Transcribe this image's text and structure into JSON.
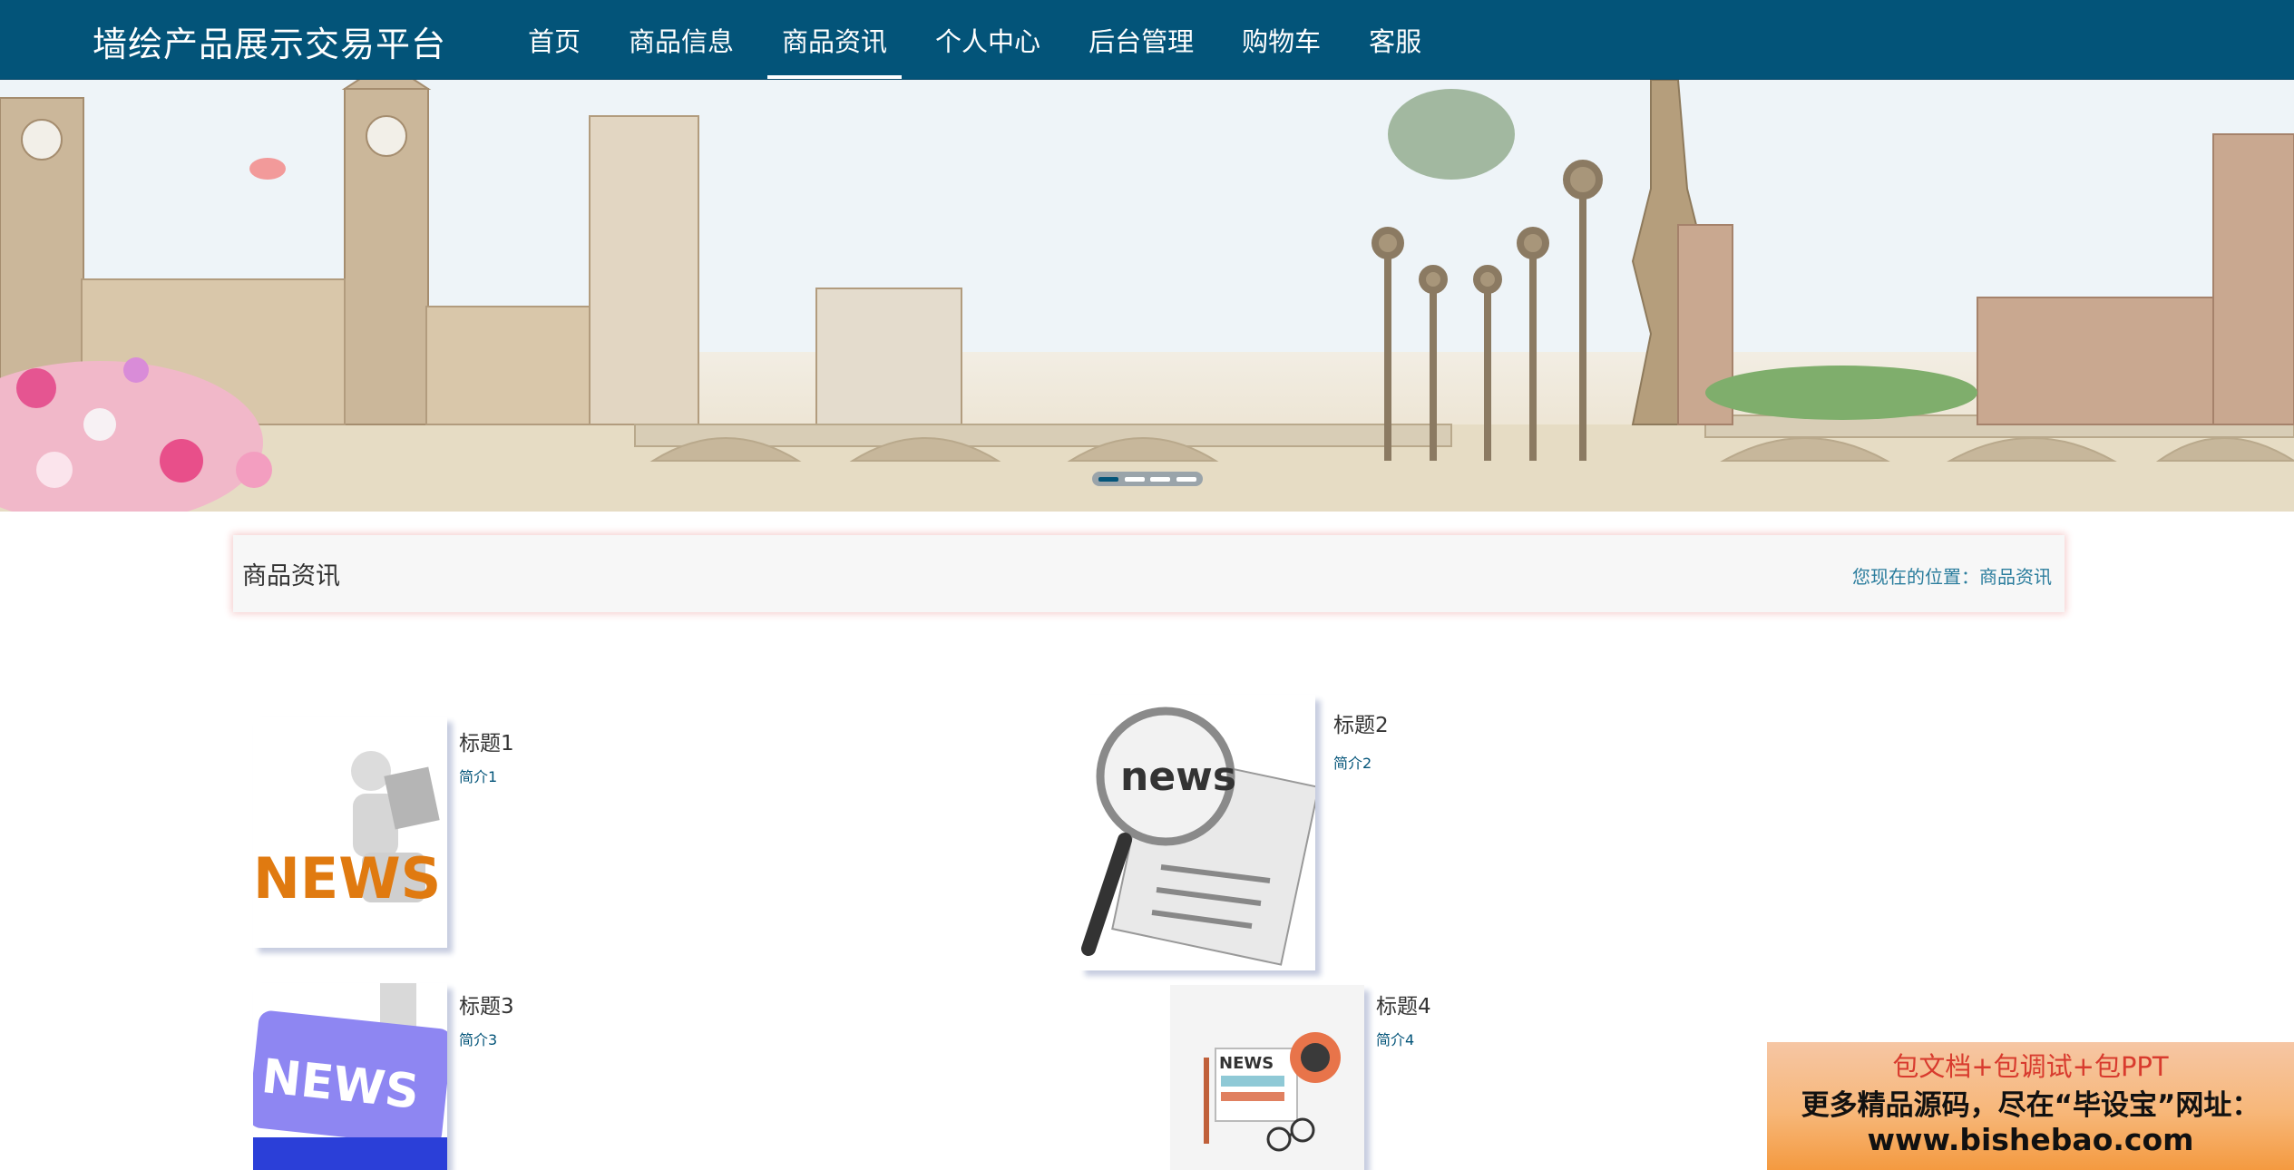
{
  "header": {
    "site_title": "墙绘产品展示交易平台",
    "nav": [
      {
        "label": "首页"
      },
      {
        "label": "商品信息"
      },
      {
        "label": "商品资讯"
      },
      {
        "label": "个人中心"
      },
      {
        "label": "后台管理"
      },
      {
        "label": "购物车"
      },
      {
        "label": "客服"
      }
    ],
    "active_nav": "商品资讯"
  },
  "banner": {
    "slide_count": 4,
    "active_slide": 1
  },
  "breadcrumb": {
    "title": "商品资讯",
    "location_prefix": "您现在的位置：",
    "location_current": "商品资讯"
  },
  "news": [
    {
      "title": "标题1",
      "summary": "简介1",
      "image": "news-3d-figure"
    },
    {
      "title": "标题2",
      "summary": "简介2",
      "image": "news-magnifier"
    },
    {
      "title": "标题3",
      "summary": "简介3",
      "image": "news-key"
    },
    {
      "title": "标题4",
      "summary": "简介4",
      "image": "news-desk"
    }
  ],
  "ad": {
    "line1": "包文档+包调试+包PPT",
    "line2": "更多精品源码，尽在“毕设宝”网址：",
    "line3": "www.bishebao.com"
  },
  "colors": {
    "nav_bg": "#035479",
    "link": "#2b7d9d",
    "shadow": "#f6cfcf"
  }
}
